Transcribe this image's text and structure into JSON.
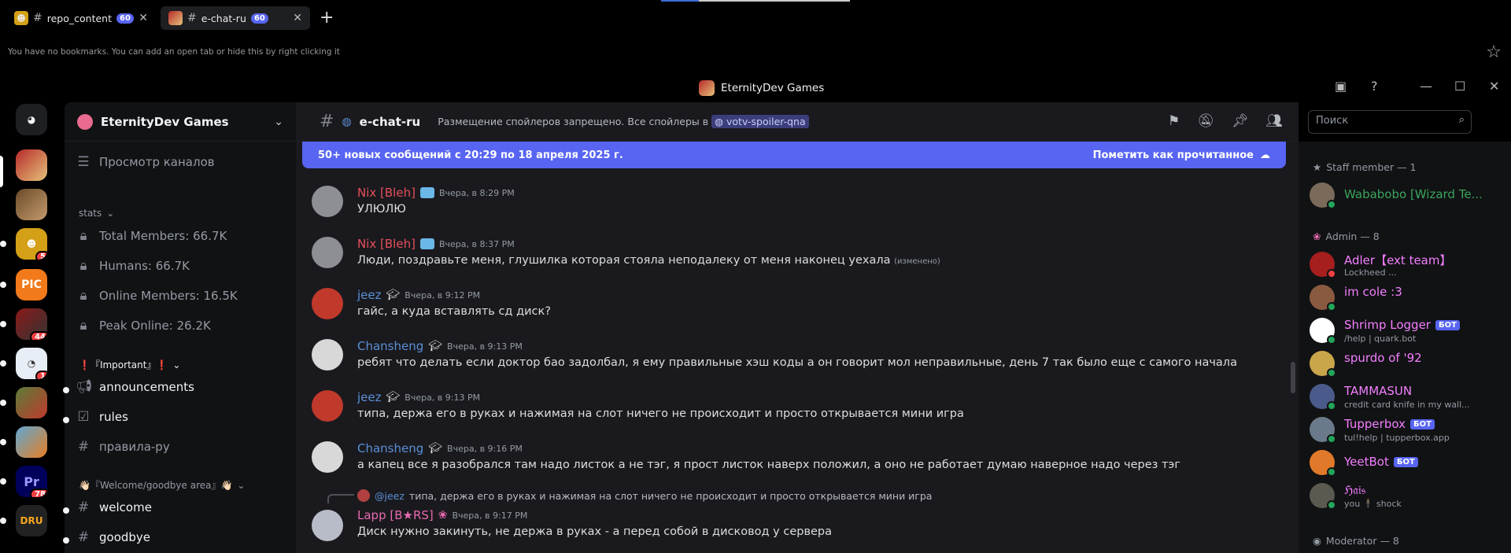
{
  "browser": {
    "tabs": [
      {
        "label": "repo_content",
        "badge": "60"
      },
      {
        "label": "e-chat-ru",
        "badge": "60"
      }
    ],
    "bookmark_message": "You have no bookmarks. You can add an open tab or hide this by right clicking it"
  },
  "window": {
    "title": "EternityDev Games"
  },
  "rail": {
    "badges": [
      "5",
      "44",
      "1",
      "78"
    ]
  },
  "guild": {
    "name": "EternityDev Games"
  },
  "sidebar": {
    "browse": "Просмотр каналов",
    "stats_category": "stats",
    "stats": [
      "Total Members: 66.7K",
      "Humans: 66.7K",
      "Online Members: 16.5K",
      "Peak Online: 26.2K"
    ],
    "important_category": "❗『Important』❗",
    "important_channels": [
      "announcements",
      "rules",
      "правила-ру"
    ],
    "welcome_category": "👋🏻『Welcome/goodbye area』👋🏻",
    "welcome_channels": [
      "welcome",
      "goodbye"
    ]
  },
  "channel": {
    "name": "e-chat-ru",
    "topic": "Размещение спойлеров запрещено. Все спойлеры в",
    "topic_link": "votv-spoiler-qna",
    "search_placeholder": "Поиск"
  },
  "newbar": {
    "text": "50+ новых сообщений с 20:29 по 18 апреля 2025 г.",
    "mark": "Пометить как прочитанное"
  },
  "messages": [
    {
      "user": "Nix [Bleh]",
      "time": "Вчера, в 8:29 PM",
      "text": "УЛЮЛЮ",
      "color": "#e64f5b"
    },
    {
      "user": "Nix [Bleh]",
      "time": "Вчера, в 8:37 PM",
      "text": "Люди, поздравьте меня, глушилка которая стояла неподалеку от меня наконец уехала",
      "edited": "(изменено)",
      "color": "#e64f5b"
    },
    {
      "user": "jeez",
      "time": "Вчера, в 9:12 PM",
      "text": "гайс, а куда вставлять сд диск?",
      "color": "#5a8fd6"
    },
    {
      "user": "Chansheng",
      "time": "Вчера, в 9:13 PM",
      "text": "ребят что делать если доктор бао задолбал, я ему правильные хэш коды а он говорит мол неправильные, день 7 так было еще с самого начала",
      "color": "#5a8fd6"
    },
    {
      "user": "jeez",
      "time": "Вчера, в 9:13 PM",
      "text": "типа, держа его в руках и нажимая на слот ничего не происходит и просто открывается мини игра",
      "color": "#5a8fd6"
    },
    {
      "user": "Chansheng",
      "time": "Вчера, в 9:16 PM",
      "text": "а капец все я разобрался там надо листок а не тэг, я прост листок наверх положил, а оно не работает думаю наверное надо через тэг",
      "color": "#5a8fd6"
    },
    {
      "user": "Lapp [B★RS]",
      "time": "Вчера, в 9:17 PM",
      "text": "Диск нужно закинуть, не держа в руках - а перед собой в дисковод у сервера",
      "color": "#e86ab0",
      "reply_user": "@jeez",
      "reply_text": "типа, держа его в руках и нажимая на слот ничего не происходит и просто открывается мини игра"
    }
  ],
  "members": {
    "categories": [
      "Staff member — 1",
      "Admin — 8",
      "Moderator — 8"
    ],
    "list": [
      {
        "name": "Wababobo [Wizard Te...",
        "sub": "",
        "color": "#3ba55c"
      },
      {
        "name": "Adler【ext team】",
        "sub": "Lockheed ...",
        "color": "#f47fff"
      },
      {
        "name": "im cole :3",
        "sub": "",
        "color": "#f47fff"
      },
      {
        "name": "Shrimp Logger",
        "sub": "/help | quark.bot",
        "color": "#f47fff",
        "bot": "БОТ"
      },
      {
        "name": "spurdo of '92",
        "sub": "",
        "color": "#f47fff"
      },
      {
        "name": "TAMMASUN",
        "sub": "credit card knife in my wall...",
        "color": "#f47fff"
      },
      {
        "name": "Tupperbox",
        "sub": "tul!help | tupperbox.app",
        "color": "#f47fff",
        "bot": "БОТ"
      },
      {
        "name": "YeetBot",
        "sub": "",
        "color": "#f47fff",
        "bot": "БОТ"
      },
      {
        "name": "ℌ𝔞𝔦𝔰",
        "sub": "you 🕴 shock",
        "color": "#f47fff"
      }
    ]
  },
  "colors": {
    "accent": "#5865f2",
    "bg_main": "#1a1a1e",
    "bg_side": "#111214"
  }
}
